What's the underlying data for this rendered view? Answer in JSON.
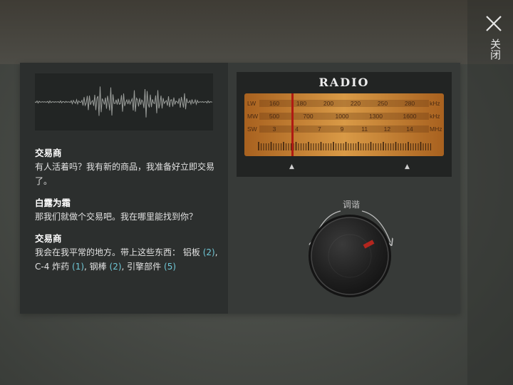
{
  "close_button": {
    "label": "关闭"
  },
  "radio": {
    "title": "RADIO",
    "bands": [
      {
        "name": "LW",
        "unit": "kHz",
        "ticks": [
          "160",
          "180",
          "200",
          "220",
          "250",
          "280"
        ]
      },
      {
        "name": "MW",
        "unit": "kHz",
        "ticks": [
          "500",
          "700",
          "1000",
          "1300",
          "1600"
        ]
      },
      {
        "name": "SW",
        "unit": "MHz",
        "ticks": [
          "3",
          "4",
          "7",
          "9",
          "11",
          "12",
          "14"
        ]
      }
    ],
    "tune_label": "调谐"
  },
  "dialogue": [
    {
      "speaker": "交易商",
      "text": "有人活着吗？我有新的商品，我准备好立即交易了。"
    },
    {
      "speaker": "白露为霜",
      "text": "那我们就做个交易吧。我在哪里能找到你？"
    },
    {
      "speaker": "交易商",
      "text_prefix": "我会在我平常的地方。带上这些东西：",
      "items": [
        {
          "name": "铝板",
          "qty": "2"
        },
        {
          "name": "C-4 炸药",
          "qty": "1"
        },
        {
          "name": "钢棒",
          "qty": "2"
        },
        {
          "name": "引擎部件",
          "qty": "5"
        }
      ]
    }
  ],
  "colors": {
    "accent_quantity": "#6fc7d6",
    "dial_needle": "#b01a12",
    "knob_indicator": "#b3261e",
    "dial_background": "#c77a28"
  }
}
